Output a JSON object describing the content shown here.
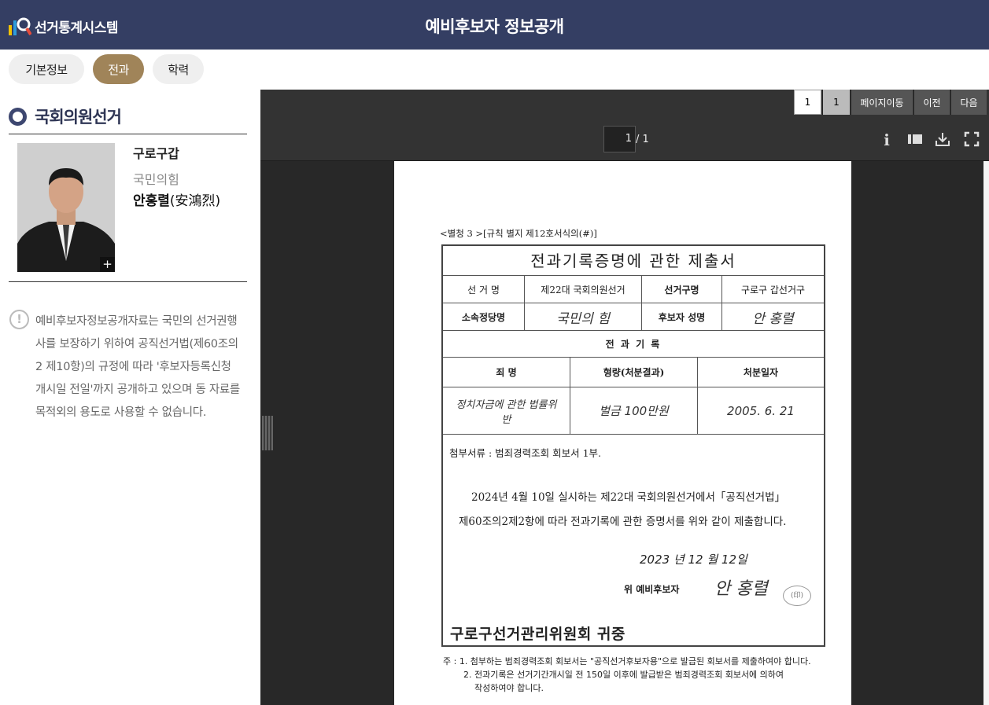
{
  "header": {
    "app_name": "선거통계시스템",
    "title": "예비후보자 정보공개"
  },
  "tabs": [
    {
      "label": "기본정보",
      "active": false
    },
    {
      "label": "전과",
      "active": true
    },
    {
      "label": "학력",
      "active": false
    }
  ],
  "sidebar": {
    "section_title": "국회의원선거",
    "candidate": {
      "district": "구로구갑",
      "party": "국민의힘",
      "name": "안홍렬",
      "name_hanja": "(安鴻烈)",
      "photo_expand_label": "+"
    },
    "notice": "예비후보자정보공개자료는 국민의 선거권행사를 보장하기 위하여 공직선거법(제60조의2 제10항)의 규정에 따라 '후보자등록신청개시일 전일'까지 공개하고 있으며 동 자료를 목적외의 용도로 사용할 수 없습니다."
  },
  "viewer": {
    "pager": {
      "page_box_1": "1",
      "page_box_2": "1",
      "goto_label": "페이지이동",
      "prev_label": "이전",
      "next_label": "다음"
    },
    "current_page": "1",
    "total_pages": "/ 1",
    "toolbar_icons": [
      "info-icon",
      "sidebar-toggle-icon",
      "download-icon",
      "fullscreen-icon"
    ]
  },
  "document": {
    "form_label": "<별청 3 >[규칙 별지 제12호서식의(#)]",
    "title": "전과기록증명에 관한 제출서",
    "row1": {
      "label1": "선 거 명",
      "value1": "제22대 국회의원선거",
      "label2": "선거구명",
      "value2": "구로구 갑선거구"
    },
    "row2": {
      "label1": "소속정당명",
      "value1": "국민의 힘",
      "label2": "후보자 성명",
      "value2": "안 홍렬"
    },
    "record_header": "전 과 기 록",
    "columns": [
      "죄 명",
      "형량(처분결과)",
      "처분일자"
    ],
    "record": {
      "crime": "정치자금에 관한 법률위반",
      "sentence": "벌금 100만원",
      "date": "2005. 6. 21"
    },
    "attachment": "첨부서류 : 범죄경력조회 회보서 1부.",
    "body_line1": "2024년 4월 10일 실시하는   제22대 국회의원선거에서「공직선거법」",
    "body_line2": "제60조의2제2항에 따라 전과기록에 관한 증명서를 위와 같이 제출합니다.",
    "date_handwritten": "2023 년 12 월 12일",
    "signer_label": "위   예비후보자",
    "signature": "안 홍렬",
    "addressee": "구로구선거관리위원회 귀중",
    "note_line1": "주 : 1. 첨부하는 범죄경력조회 회보서는 \"공직선거후보자용\"으로 발급된 회보서를 제출하여야 합니다.",
    "note_line2": "2. 전과기록은 선거기간개시일 전 150일 이후에 발급받은 범죄경력조회 회보서에 의하여",
    "note_line3": "작성하여야 합니다."
  },
  "colors": {
    "header_bg": "#343e63",
    "active_tab": "#a08459",
    "viewer_bg": "#282828"
  }
}
